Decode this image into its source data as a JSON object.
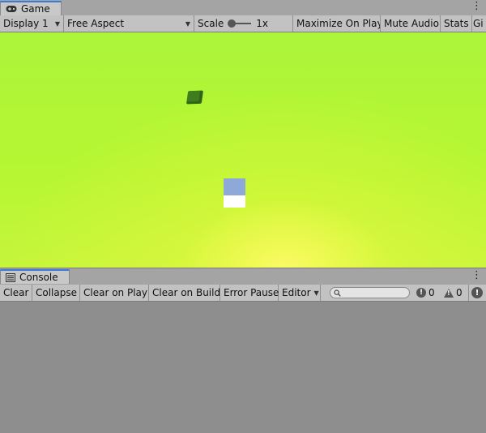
{
  "game_tab": {
    "label": "Game",
    "icon": "gamepad-icon"
  },
  "game_toolbar": {
    "display": "Display 1",
    "aspect": "Free Aspect",
    "scale_label": "Scale",
    "scale_value": "1x",
    "maximize_on_play": "Maximize On Play",
    "mute_audio": "Mute Audio",
    "stats": "Stats",
    "gizmos": "Gi"
  },
  "game_view": {
    "background_color": "#b2f534",
    "sun_glow_color": "#fbfb6a",
    "objects": [
      {
        "name": "green-cube",
        "color": "#3e7d1e"
      },
      {
        "name": "white-cube",
        "top_color": "#8ea8d8",
        "bottom_color": "#ffffff"
      }
    ]
  },
  "console_tab": {
    "label": "Console",
    "icon": "console-list-icon"
  },
  "console_toolbar": {
    "clear": "Clear",
    "collapse": "Collapse",
    "clear_on_play": "Clear on Play",
    "clear_on_build": "Clear on Build",
    "error_pause": "Error Pause",
    "editor": "Editor",
    "search_placeholder": "",
    "info_count": "0",
    "warning_count": "0",
    "error_count": ""
  }
}
